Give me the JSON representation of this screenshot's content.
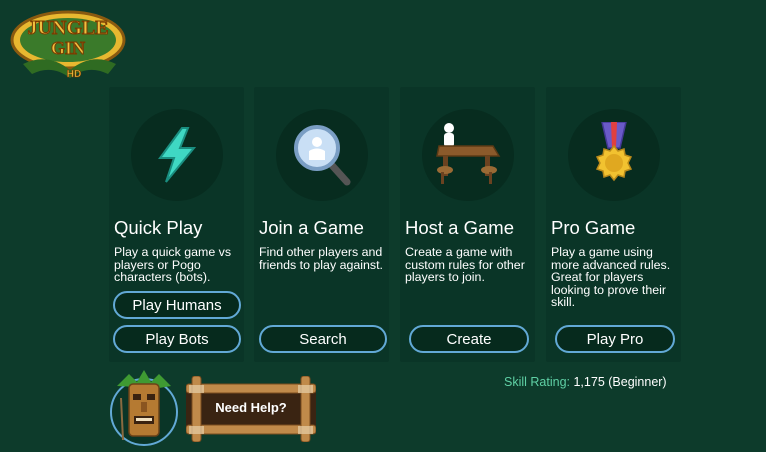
{
  "logo": {
    "line1": "JUNGLE",
    "line2": "GIN",
    "line3": "HD"
  },
  "cards": [
    {
      "title": "Quick Play",
      "description": "Play a quick game vs players or Pogo characters (bots).",
      "icon": "lightning-icon",
      "buttons": [
        "Play Humans",
        "Play Bots"
      ]
    },
    {
      "title": "Join a Game",
      "description": "Find other players and friends to play against.",
      "icon": "magnifier-icon",
      "buttons": [
        "Search"
      ]
    },
    {
      "title": "Host a Game",
      "description": "Create a game with custom rules for other players to join.",
      "icon": "table-icon",
      "buttons": [
        "Create"
      ]
    },
    {
      "title": "Pro Game",
      "description": "Play a game using more advanced rules. Great for players looking to prove their skill.",
      "icon": "medal-icon",
      "buttons": [
        "Play Pro"
      ]
    }
  ],
  "skill": {
    "label": "Skill Rating:",
    "value": "1,175 (Beginner)"
  },
  "help": {
    "label": "Need Help?"
  },
  "colors": {
    "background": "#0d3b2b",
    "card": "#0a3527",
    "button_border": "#62a9d6",
    "accent_green": "#5fd0a5"
  }
}
